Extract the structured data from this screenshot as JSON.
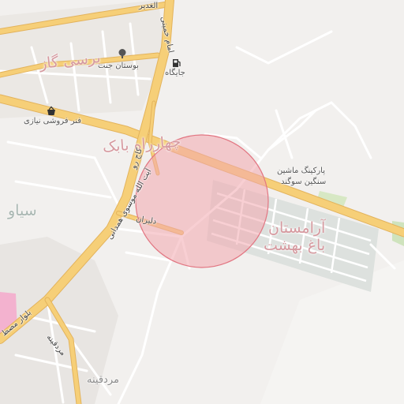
{
  "map": {
    "labels": {
      "al_ghadir": "الغدیر",
      "imam_khomeini": "امام خمینی",
      "bustan_jannat": "بوستان جنت",
      "jaygah": "جایگاه",
      "barsi_gaz": "برسی گاز",
      "far_forushi_niazi": "فنر فروشی نیازی",
      "chaharrah_babak": "چهارراه بابک",
      "kaj_ru": "کاج رو",
      "parking_1": "پارکینگ ماشین",
      "parking_2": "سنگین سوگند",
      "siyav": "سیاو",
      "dlbran": "دلبران",
      "arامستان_1": "آرامستان",
      "aramestan_2": "باغ بهشت",
      "ayatollah_road": "آیت الله موسوی همدانی",
      "bolvar_mostafa": "بلوار مصط",
      "mardqina_small": "مردقینه",
      "mardqina_big": "مردقینه"
    },
    "icons": {
      "park": "tree-icon",
      "fuel": "fuel-pump-icon",
      "shop": "shopping-basket-icon"
    },
    "colors": {
      "background": "#f2f0ee",
      "major_road": "#f6cf78",
      "major_road_edge": "#e3b35c",
      "minor_road": "#ffffff",
      "circle_fill": "#f3a8ae",
      "circle_stroke": "#e27682",
      "green_area": "#cfe3bd",
      "pink_area": "#f3b2cf"
    }
  }
}
